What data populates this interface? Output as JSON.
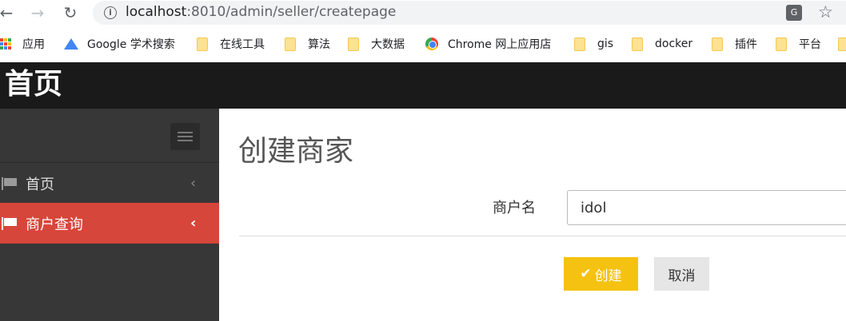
{
  "browser": {
    "url_host": "localhost",
    "url_rest": ":8010/admin/seller/createpage",
    "bookmarks": [
      {
        "label": "应用",
        "icon": "apps-grid-icon"
      },
      {
        "label": "Google 学术搜索",
        "icon": "google-scholar-icon"
      },
      {
        "label": "在线工具",
        "icon": "folder-icon"
      },
      {
        "label": "算法",
        "icon": "folder-icon"
      },
      {
        "label": "大数据",
        "icon": "folder-icon"
      },
      {
        "label": "Chrome 网上应用店",
        "icon": "chrome-icon"
      },
      {
        "label": "gis",
        "icon": "folder-icon"
      },
      {
        "label": "docker",
        "icon": "folder-icon"
      },
      {
        "label": "插件",
        "icon": "folder-icon"
      },
      {
        "label": "平台",
        "icon": "folder-icon"
      }
    ]
  },
  "header": {
    "brand": "首页"
  },
  "sidebar": {
    "items": [
      {
        "label": "首页",
        "icon": "flag-icon",
        "active": false
      },
      {
        "label": "商户查询",
        "icon": "flag-icon",
        "active": true
      }
    ]
  },
  "main": {
    "title": "创建商家",
    "form": {
      "name_label": "商户名",
      "name_value": "idol",
      "submit_label": "创建",
      "cancel_label": "取消"
    }
  },
  "colors": {
    "header_bg": "#1a1a1a",
    "sidebar_bg": "#373737",
    "active_item": "#d7463a",
    "create_button": "#f5c211"
  }
}
